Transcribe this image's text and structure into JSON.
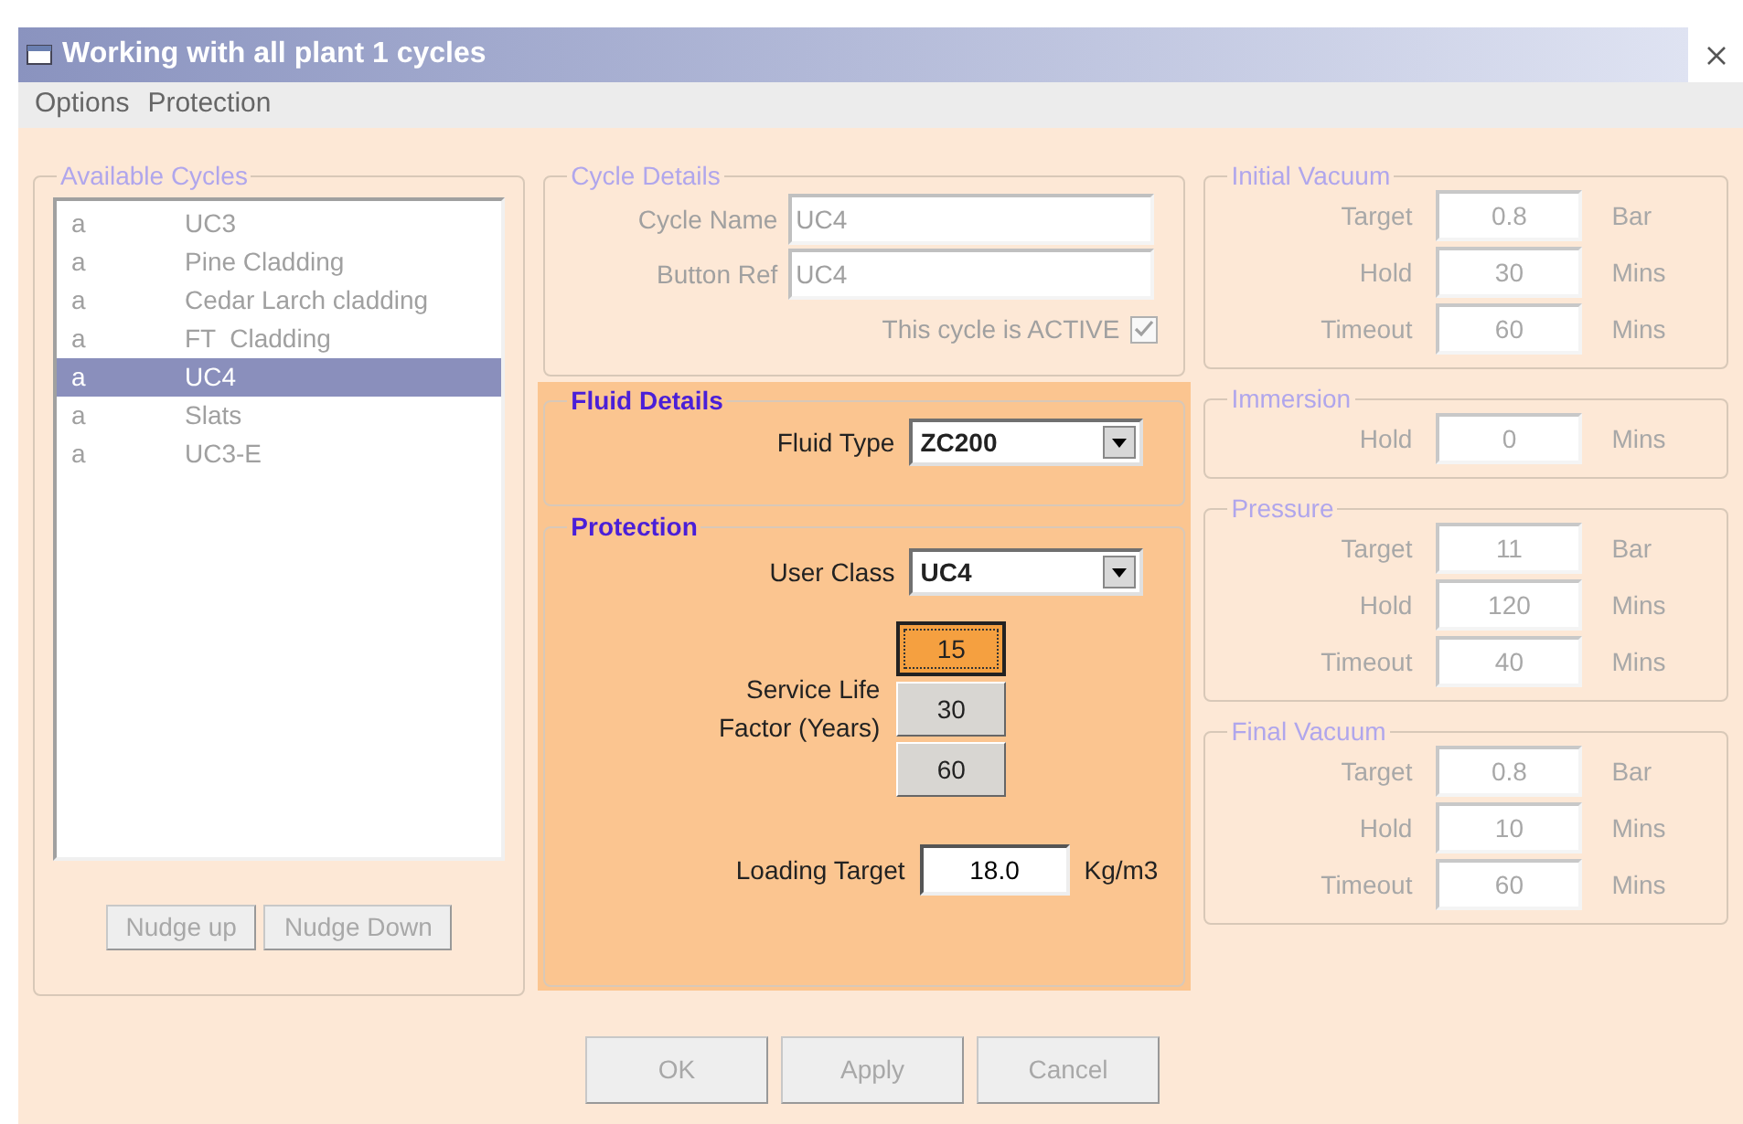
{
  "window": {
    "title": "Working with all plant 1 cycles"
  },
  "menu": [
    "Options",
    "Protection"
  ],
  "available_cycles": {
    "title": "Available Cycles",
    "disabled": true,
    "items": [
      {
        "code": "a",
        "name": "UC3",
        "selected": false
      },
      {
        "code": "a",
        "name": "Pine Cladding",
        "selected": false
      },
      {
        "code": "a",
        "name": "Cedar Larch cladding",
        "selected": false
      },
      {
        "code": "a",
        "name": "FT  Cladding",
        "selected": false
      },
      {
        "code": "a",
        "name": "UC4",
        "selected": true
      },
      {
        "code": "a",
        "name": "Slats",
        "selected": false
      },
      {
        "code": "a",
        "name": "UC3-E",
        "selected": false
      }
    ],
    "buttons": [
      {
        "label": "Nudge up",
        "disabled": true
      },
      {
        "label": "Nudge Down",
        "disabled": true
      }
    ]
  },
  "cycle_details": {
    "title": "Cycle Details",
    "disabled": true,
    "fields": [
      {
        "label": "Cycle Name",
        "value": "UC4"
      },
      {
        "label": "Button Ref",
        "value": "UC4"
      }
    ],
    "active": {
      "label": "This cycle is ACTIVE",
      "checked": true
    }
  },
  "fluid_details": {
    "title": "Fluid Details",
    "disabled": false,
    "fluid_type": {
      "label": "Fluid Type",
      "value": "ZC200"
    }
  },
  "protection": {
    "title": "Protection",
    "disabled": false,
    "user_class": {
      "label": "User Class",
      "value": "UC4"
    },
    "service_life": {
      "label": "Service Life Factor (Years)",
      "options": [
        {
          "label": "15",
          "selected": true
        },
        {
          "label": "30",
          "selected": false
        },
        {
          "label": "60",
          "selected": false
        }
      ]
    },
    "loading_target": {
      "label": "Loading Target",
      "value": "18.0",
      "unit": "Kg/m3"
    }
  },
  "stages": [
    {
      "title": "Initial Vacuum",
      "disabled": true,
      "rows": [
        {
          "label": "Target",
          "value": "0.8",
          "unit": "Bar"
        },
        {
          "label": "Hold",
          "value": "30",
          "unit": "Mins"
        },
        {
          "label": "Timeout",
          "value": "60",
          "unit": "Mins"
        }
      ]
    },
    {
      "title": "Immersion",
      "disabled": true,
      "rows": [
        {
          "label": "Hold",
          "value": "0",
          "unit": "Mins"
        }
      ]
    },
    {
      "title": "Pressure",
      "disabled": true,
      "rows": [
        {
          "label": "Target",
          "value": "11",
          "unit": "Bar"
        },
        {
          "label": "Hold",
          "value": "120",
          "unit": "Mins"
        },
        {
          "label": "Timeout",
          "value": "40",
          "unit": "Mins"
        }
      ]
    },
    {
      "title": "Final Vacuum",
      "disabled": true,
      "rows": [
        {
          "label": "Target",
          "value": "0.8",
          "unit": "Bar"
        },
        {
          "label": "Hold",
          "value": "10",
          "unit": "Mins"
        },
        {
          "label": "Timeout",
          "value": "60",
          "unit": "Mins"
        }
      ]
    }
  ],
  "buttons": [
    {
      "label": "OK",
      "disabled": true
    },
    {
      "label": "Apply",
      "disabled": true
    },
    {
      "label": "Cancel",
      "disabled": true
    }
  ]
}
